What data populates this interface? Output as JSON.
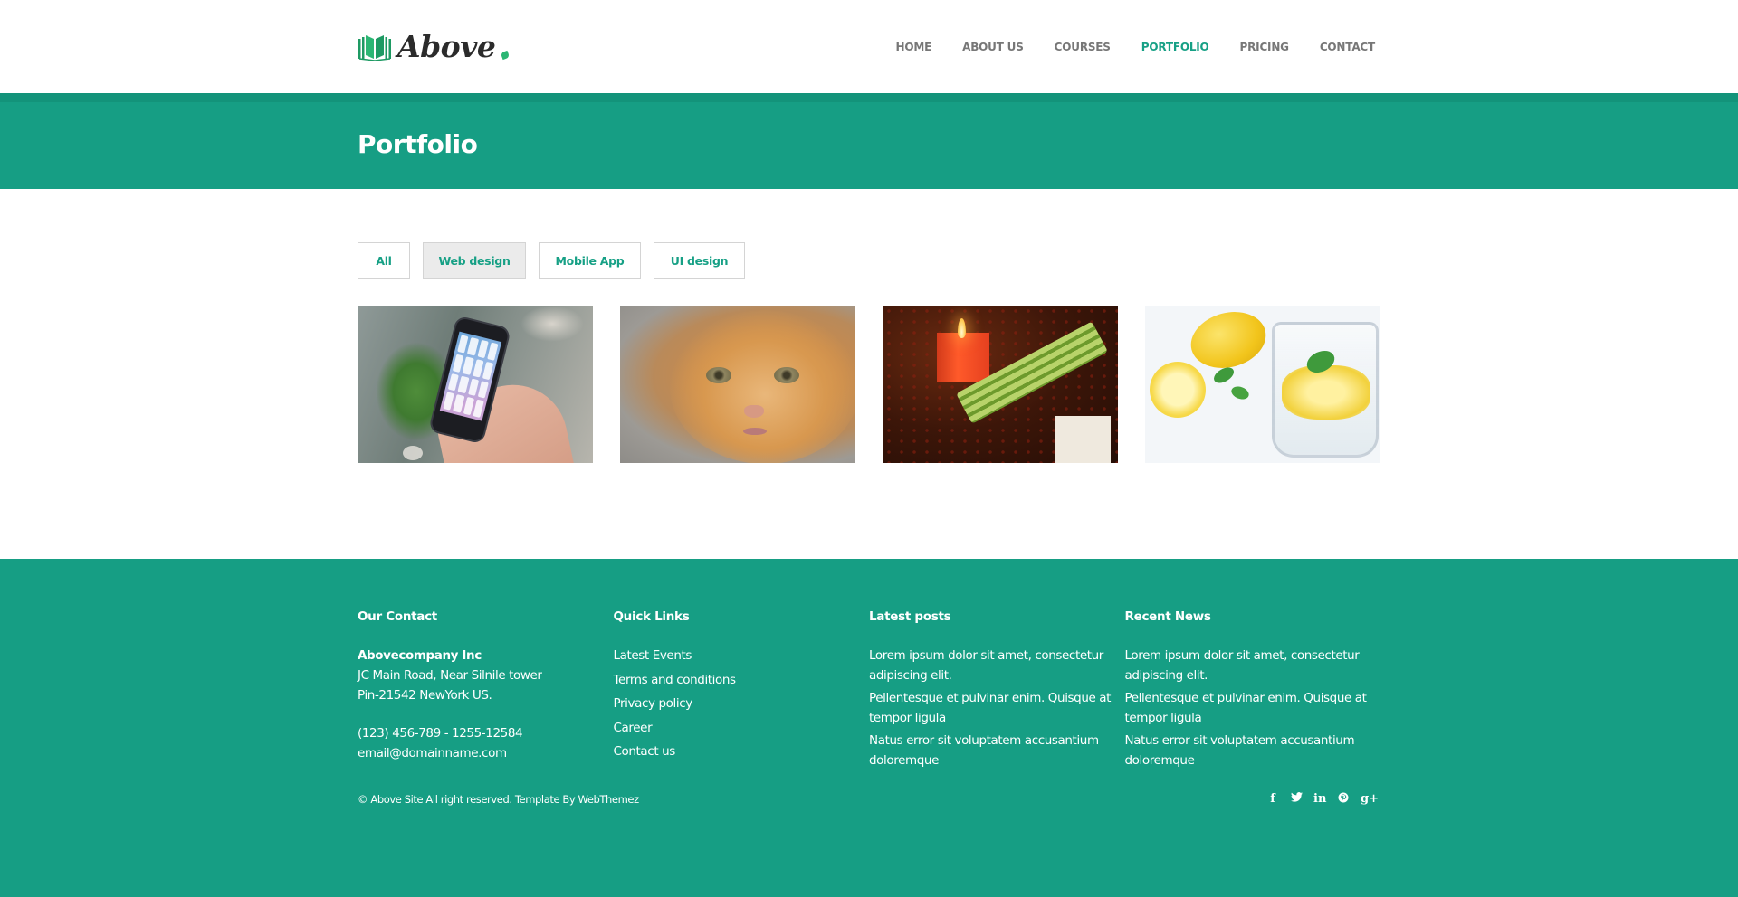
{
  "brand": {
    "name": "Above",
    "accent_color": "#16a085",
    "logo_icon": "open-book-icon"
  },
  "nav": {
    "items": [
      {
        "label": "HOME",
        "active": false
      },
      {
        "label": "ABOUT US",
        "active": false
      },
      {
        "label": "COURSES",
        "active": false
      },
      {
        "label": "PORTFOLIO",
        "active": true
      },
      {
        "label": "PRICING",
        "active": false
      },
      {
        "label": "CONTACT",
        "active": false
      }
    ]
  },
  "banner": {
    "title": "Portfolio"
  },
  "filters": {
    "items": [
      {
        "label": "All",
        "active": false
      },
      {
        "label": "Web design",
        "active": true
      },
      {
        "label": "Mobile App",
        "active": false
      },
      {
        "label": "UI design",
        "active": false
      }
    ]
  },
  "gallery": {
    "items": [
      {
        "subject": "hand holding smartphone"
      },
      {
        "subject": "orange cat face"
      },
      {
        "subject": "red candle with flowers and I love you card"
      },
      {
        "subject": "lemons and glass of lemon water with mint"
      }
    ]
  },
  "footer": {
    "contact": {
      "heading": "Our Contact",
      "company": "Abovecompany Inc",
      "address_line1": "JC Main Road, Near Silnile tower",
      "address_line2": "Pin-21542 NewYork US.",
      "phone": "(123) 456-789 - 1255-12584",
      "email": "email@domainname.com"
    },
    "quick_links": {
      "heading": "Quick Links",
      "items": [
        "Latest Events",
        "Terms and conditions",
        "Privacy policy",
        "Career",
        "Contact us"
      ]
    },
    "latest_posts": {
      "heading": "Latest posts",
      "items": [
        "Lorem ipsum dolor sit amet, consectetur adipiscing elit.",
        "Pellentesque et pulvinar enim. Quisque at tempor ligula",
        "Natus error sit voluptatem accusantium doloremque"
      ]
    },
    "recent_news": {
      "heading": "Recent News",
      "items": [
        "Lorem ipsum dolor sit amet, consectetur adipiscing elit.",
        "Pellentesque et pulvinar enim. Quisque at tempor ligula",
        "Natus error sit voluptatem accusantium doloremque"
      ]
    },
    "copyright": "© Above Site All right reserved. Template By WebThemez",
    "social": [
      {
        "name": "facebook-icon",
        "glyph": "f"
      },
      {
        "name": "twitter-icon",
        "glyph": "🐦"
      },
      {
        "name": "linkedin-icon",
        "glyph": "in"
      },
      {
        "name": "pinterest-icon",
        "glyph": "℗"
      },
      {
        "name": "google-plus-icon",
        "glyph": "g+"
      }
    ]
  }
}
